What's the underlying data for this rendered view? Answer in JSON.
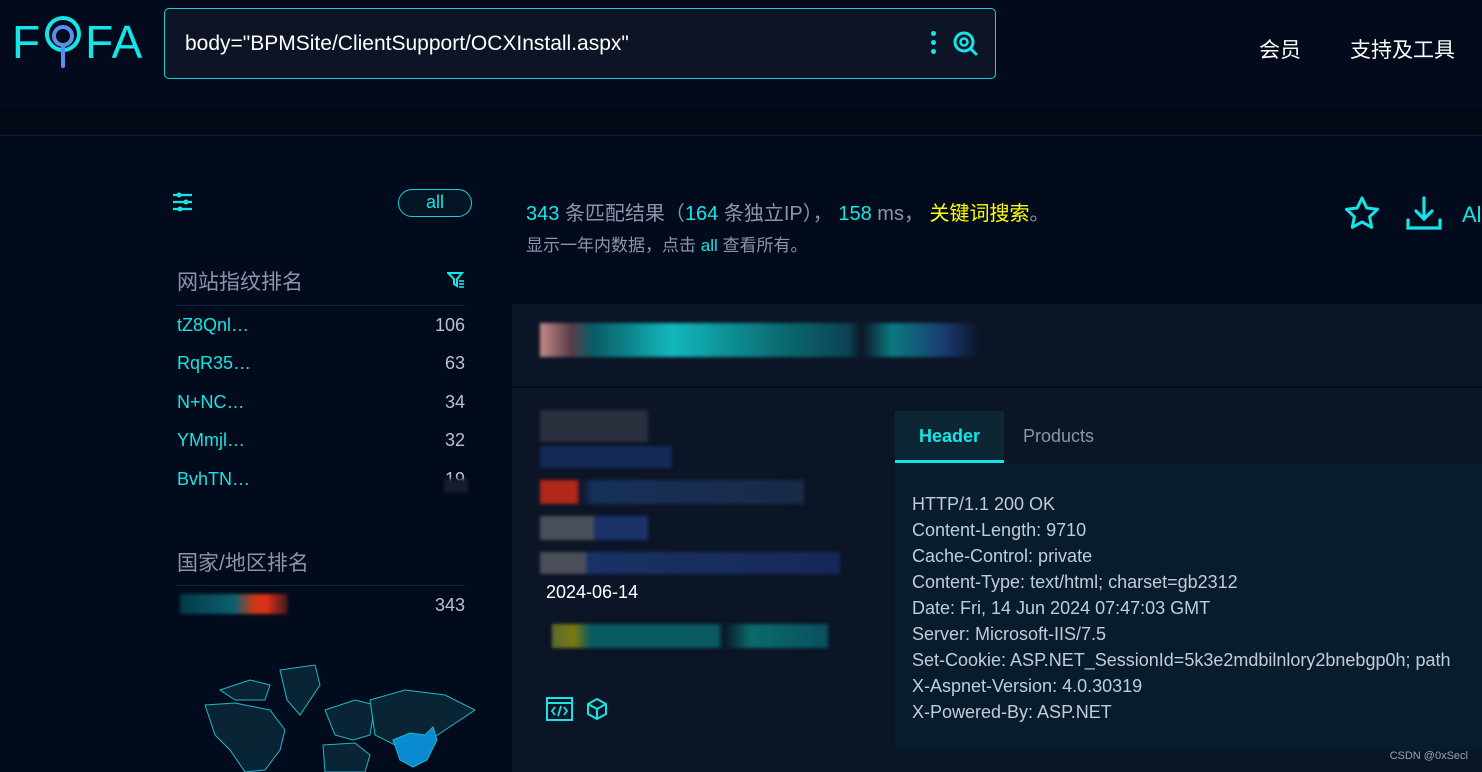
{
  "logo": {
    "text_left": "F",
    "text_right": "FA"
  },
  "search": {
    "value": "body=\"BPMSite/ClientSupport/OCXInstall.aspx\""
  },
  "nav": {
    "member": "会员",
    "tools": "支持及工具"
  },
  "sidebar": {
    "all_label": "all",
    "fingerprint_title": "网站指纹排名",
    "fingerprints": [
      {
        "name": "tZ8Qnl…",
        "count": "106"
      },
      {
        "name": "RqR35…",
        "count": "63"
      },
      {
        "name": "N+NC…",
        "count": "34"
      },
      {
        "name": "YMmjl…",
        "count": "32"
      },
      {
        "name": "BvhTN…",
        "count": "19"
      }
    ],
    "country_title": "国家/地区排名",
    "country_count": "343"
  },
  "results": {
    "count": "343",
    "count_label": "条匹配结果（",
    "ip_count": "164",
    "ip_label": "条独立IP），",
    "ms": "158",
    "ms_label": "ms，",
    "keyword": "关键词搜索",
    "period": "。",
    "sub_before": "显示一年内数据，点击",
    "sub_all": "all",
    "sub_after": "查看所有。",
    "action_partial": "Al"
  },
  "card": {
    "date": "2024-06-14",
    "tabs": [
      "Header",
      "Products"
    ],
    "header_lines": [
      "HTTP/1.1 200 OK",
      "Content-Length: 9710",
      "Cache-Control: private",
      "Content-Type: text/html; charset=gb2312",
      "Date: Fri, 14 Jun 2024 07:47:03 GMT",
      "Server: Microsoft-IIS/7.5",
      "Set-Cookie: ASP.NET_SessionId=5k3e2mdbilnlory2bnebgp0h; path",
      "X-Aspnet-Version: 4.0.30319",
      "X-Powered-By: ASP.NET"
    ]
  },
  "watermark": "CSDN @0xSecl",
  "colors": {
    "accent": "#14e6e8",
    "keyword": "#ffff00",
    "map_highlight": "#0a8ad0"
  }
}
